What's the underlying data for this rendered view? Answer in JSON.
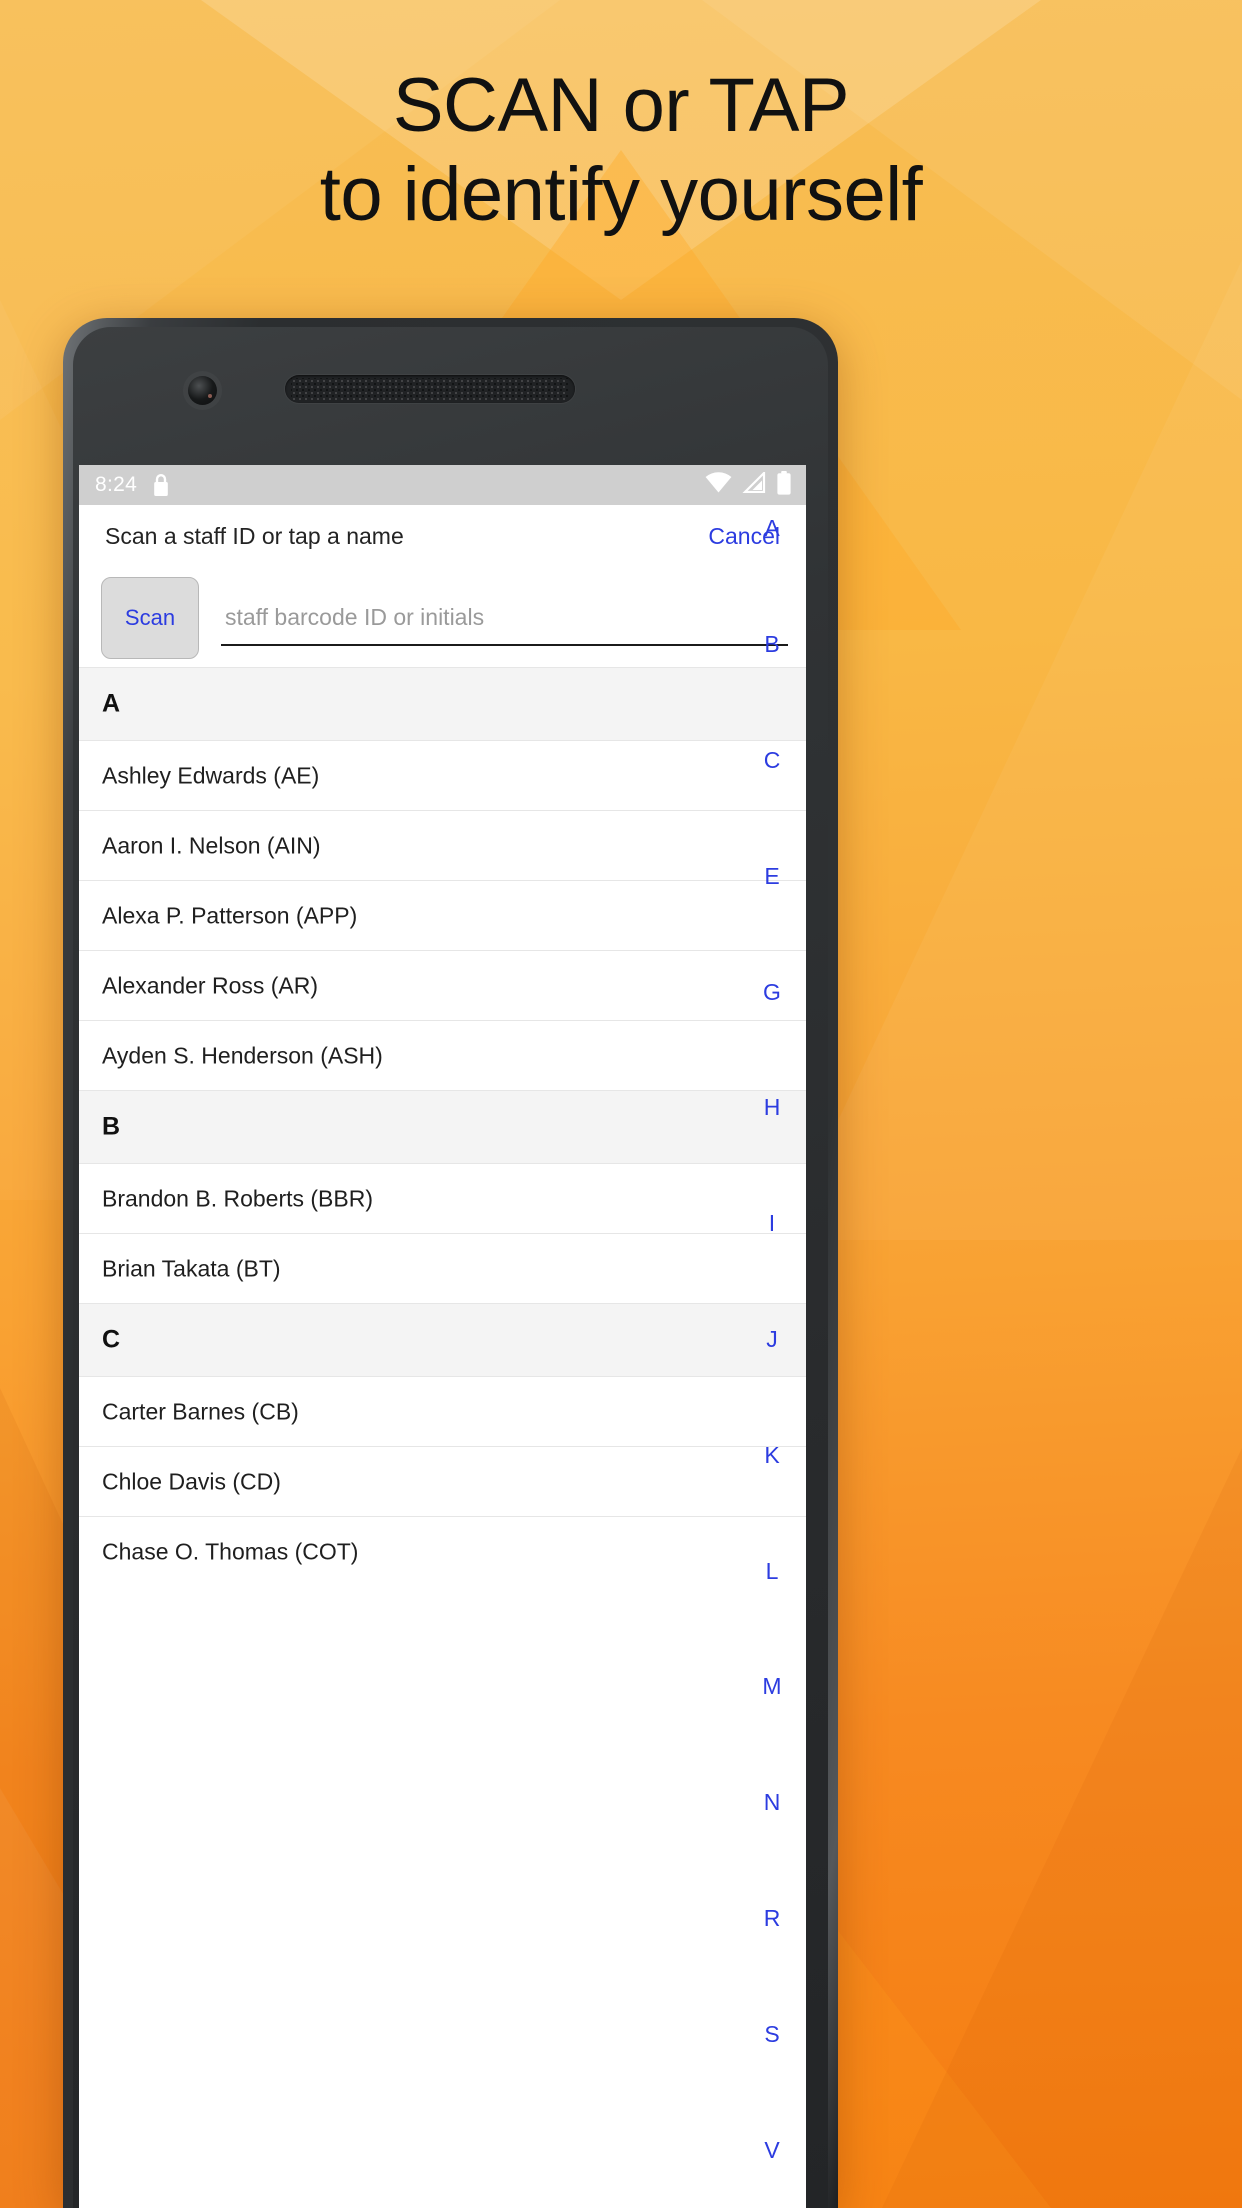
{
  "promo": {
    "headline_line1": "SCAN or TAP",
    "headline_line2": "to identify yourself",
    "background_color_top": "#F8BE55",
    "background_color_bottom": "#F57C10",
    "headline_color": "#111111"
  },
  "device": {
    "bezel_color": "#2E3133",
    "camera_icon": "front-camera",
    "speaker_icon": "earpiece-speaker"
  },
  "statusbar": {
    "time": "8:24",
    "background_color": "#CFCFCF",
    "icon_color": "#FFFFFF",
    "lock_icon": "lock-icon",
    "wifi_icon": "wifi-icon",
    "signal_icon": "cell-signal-icon",
    "battery_icon": "battery-icon"
  },
  "header": {
    "title": "Scan a staff ID or tap a name",
    "cancel_label": "Cancel",
    "link_color": "#2C3CE0"
  },
  "search": {
    "scan_label": "Scan",
    "placeholder": "staff barcode ID or initials",
    "value": ""
  },
  "list": {
    "rows": [
      {
        "type": "section",
        "text": "A"
      },
      {
        "type": "name",
        "text": "Ashley Edwards (AE)"
      },
      {
        "type": "name",
        "text": "Aaron I. Nelson (AIN)"
      },
      {
        "type": "name",
        "text": "Alexa P. Patterson (APP)"
      },
      {
        "type": "name",
        "text": "Alexander Ross (AR)"
      },
      {
        "type": "name",
        "text": "Ayden S. Henderson (ASH)"
      },
      {
        "type": "section",
        "text": "B"
      },
      {
        "type": "name",
        "text": "Brandon B. Roberts (BBR)"
      },
      {
        "type": "name",
        "text": "Brian Takata (BT)"
      },
      {
        "type": "section",
        "text": "C"
      },
      {
        "type": "name",
        "text": "Carter Barnes (CB)"
      },
      {
        "type": "name",
        "text": "Chloe Davis (CD)"
      },
      {
        "type": "name",
        "text": "Chase O. Thomas (COT)"
      }
    ]
  },
  "index_strip": {
    "letters": [
      "A",
      "B",
      "C",
      "E",
      "G",
      "H",
      "I",
      "J",
      "K",
      "L",
      "M",
      "N",
      "R",
      "S",
      "V"
    ],
    "color": "#2C3CE0"
  }
}
